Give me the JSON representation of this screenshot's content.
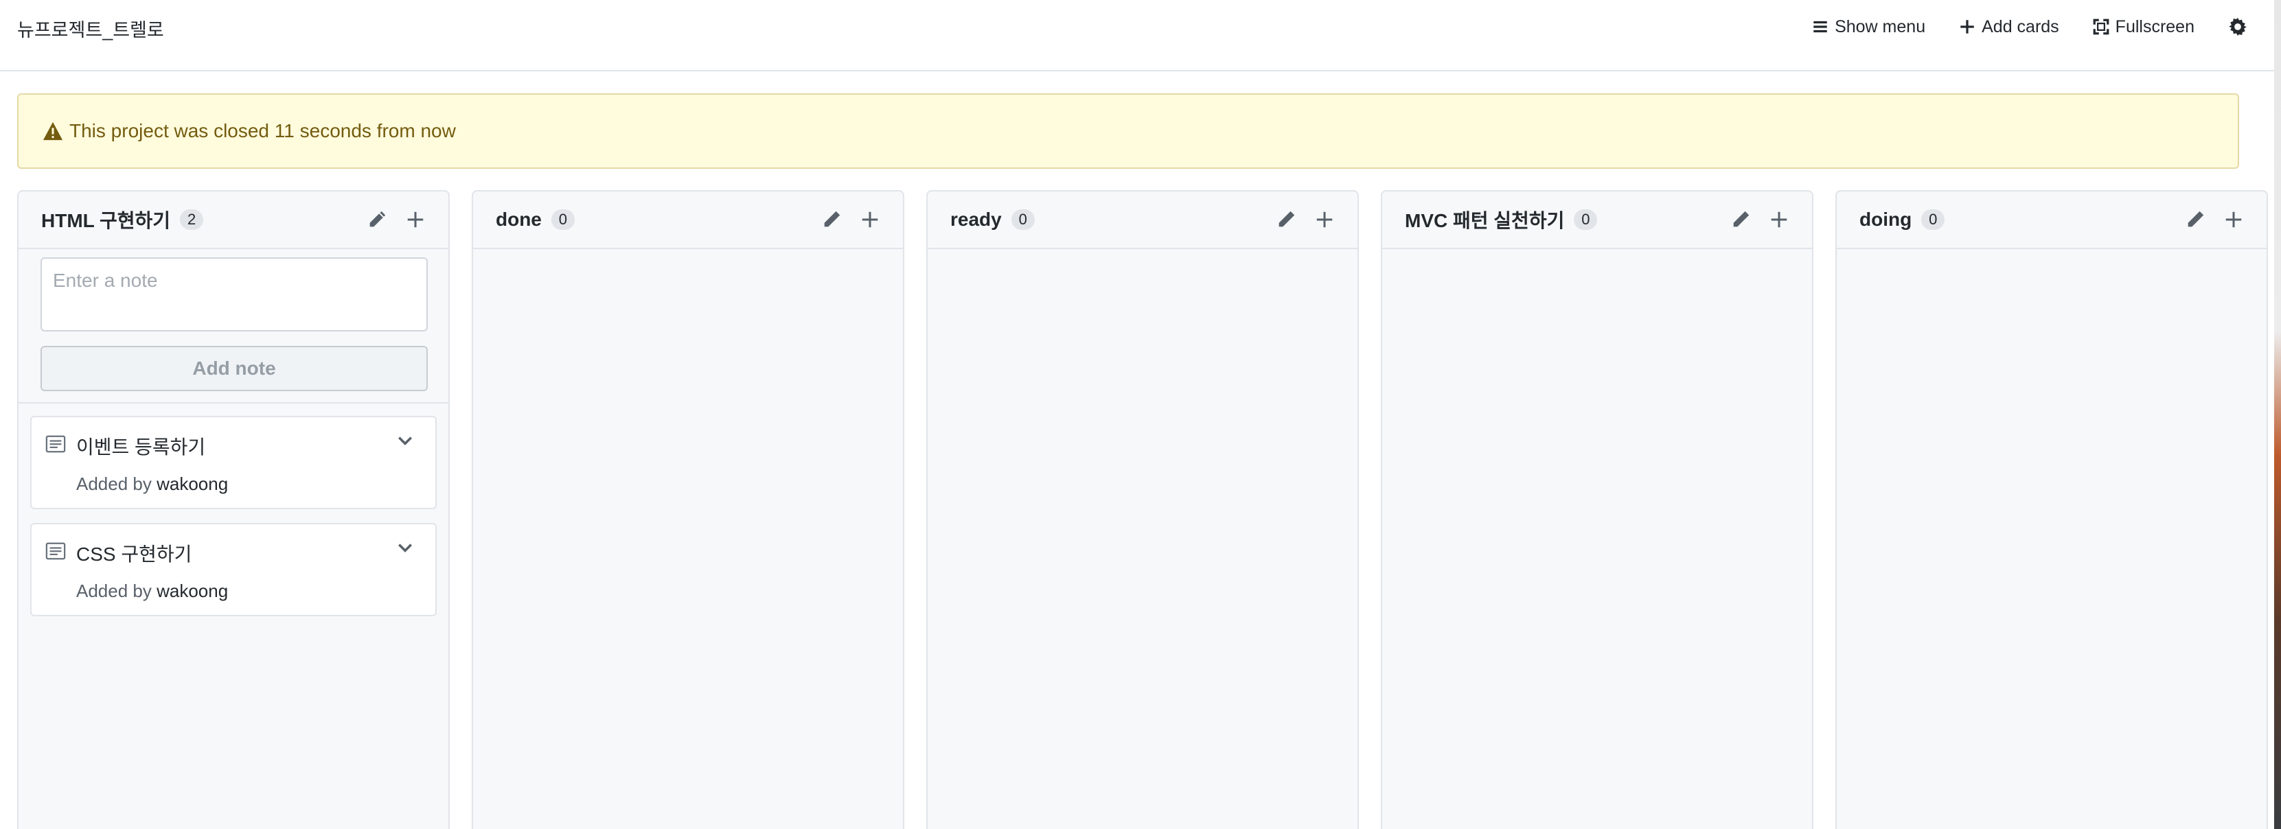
{
  "header": {
    "project_name": "뉴프로젝트_트렐로",
    "actions": [
      {
        "label": "Show menu",
        "icon": "menu-icon"
      },
      {
        "label": "Add cards",
        "icon": "plus-icon"
      },
      {
        "label": "Fullscreen",
        "icon": "fullscreen-icon"
      }
    ],
    "settings_icon": "gear-icon"
  },
  "flash": {
    "icon": "warning-icon",
    "message": "This project was closed 11 seconds from now"
  },
  "columns": [
    {
      "title": "HTML 구현하기",
      "count": "2",
      "note_form": {
        "placeholder": "Enter a note",
        "button": "Add note"
      },
      "cards": [
        {
          "title": "이벤트 등록하기",
          "added_by_label": "Added by",
          "author": "wakoong"
        },
        {
          "title": "CSS 구현하기",
          "added_by_label": "Added by",
          "author": "wakoong"
        }
      ]
    },
    {
      "title": "done",
      "count": "0",
      "cards": []
    },
    {
      "title": "ready",
      "count": "0",
      "cards": []
    },
    {
      "title": "MVC 패턴 실천하기",
      "count": "0",
      "cards": []
    },
    {
      "title": "doing",
      "count": "0",
      "cards": []
    }
  ],
  "colors": {
    "flash_bg": "#fffbdd",
    "flash_text": "#735c0f",
    "column_bg": "#f6f8fa",
    "border": "#e1e4e8"
  }
}
